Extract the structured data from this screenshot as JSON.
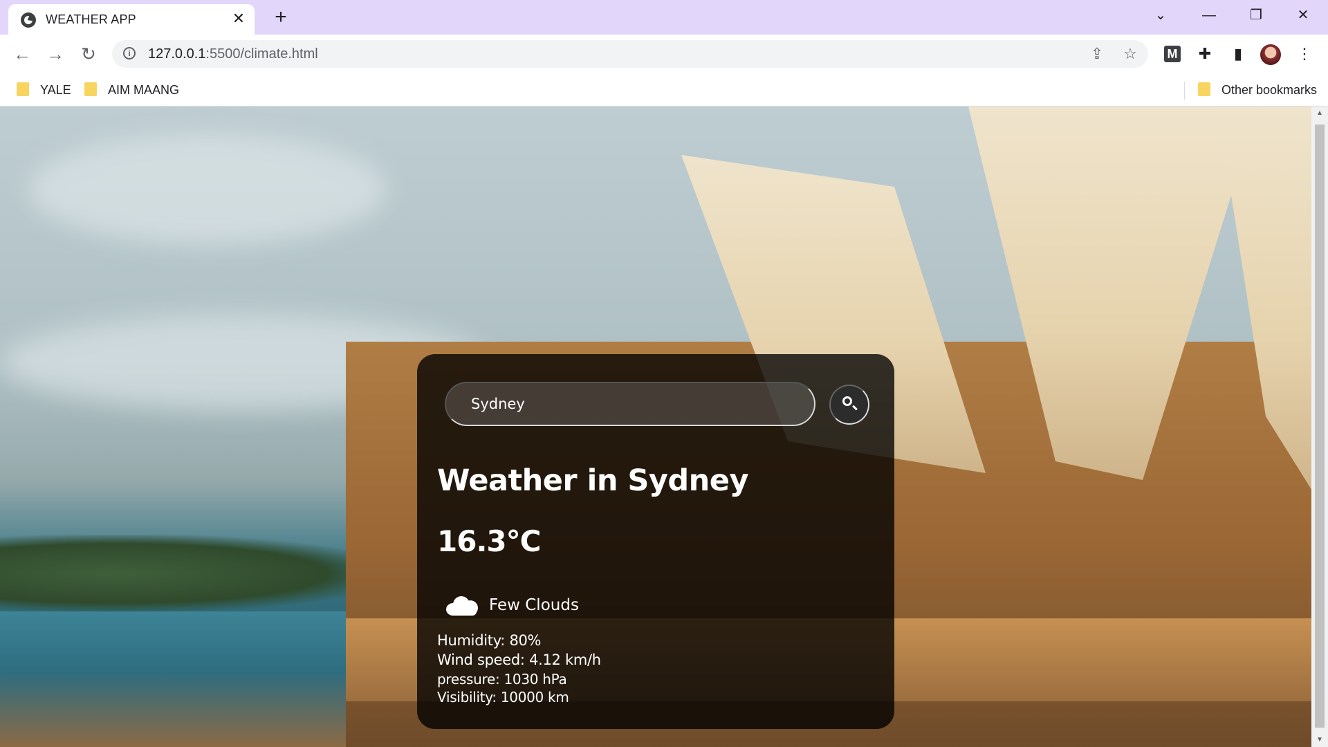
{
  "browser": {
    "tab_title": "WEATHER APP",
    "tab_close": "✕",
    "new_tab": "+",
    "window_controls": {
      "menu": "⌄",
      "minimize": "—",
      "restore": "❐",
      "close": "✕"
    },
    "nav": {
      "back": "←",
      "forward": "→",
      "reload": "↻"
    },
    "url_host": "127.0.0.1",
    "url_rest": ":5500/climate.html",
    "ext_m_label": "M",
    "menu_dots": "⋮",
    "bookmarks": [
      "YALE",
      "AIM MAANG"
    ],
    "other_bookmarks": "Other bookmarks"
  },
  "weather": {
    "search_value": "Sydney",
    "city_heading": "Weather in Sydney",
    "temperature": "16.3°C",
    "condition": "Few Clouds",
    "humidity": "Humidity: 80%",
    "wind": "Wind speed: 4.12 km/h",
    "pressure": "pressure: 1030 hPa",
    "visibility": "Visibility: 10000 km",
    "condition_icon": "cloud-icon"
  }
}
